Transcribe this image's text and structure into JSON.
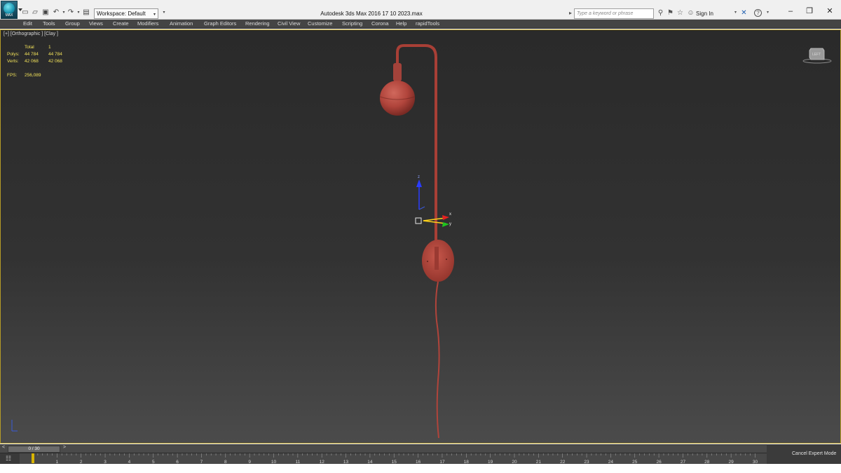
{
  "titlebar": {
    "app_button_label": "MAX",
    "workspace": "Workspace: Default",
    "window_title": "Autodesk 3ds Max 2016     17 10 2023.max",
    "search_placeholder": "Type a keyword or phrase",
    "sign_in": "Sign In"
  },
  "menu": {
    "items": [
      "Edit",
      "Tools",
      "Group",
      "Views",
      "Create",
      "Modifiers",
      "Animation",
      "Graph Editors",
      "Rendering",
      "Civil View",
      "Customize",
      "Scripting",
      "Corona",
      "Help",
      "rapidTools"
    ]
  },
  "viewport": {
    "label": "[+] [Orthographic ] [Clay ]",
    "stats": {
      "header": "Total",
      "header_value": "1",
      "polys_label": "Polys:",
      "polys_selected": "44 784",
      "polys_total": "44 784",
      "verts_label": "Verts:",
      "verts_selected": "42 068",
      "verts_total": "42 068",
      "fps_label": "FPS:",
      "fps_value": "256,089"
    },
    "gizmo_x": "x",
    "gizmo_y": "y",
    "gizmo_z": "z",
    "viewcube_label": "LEFT",
    "model_color": "#b0443b"
  },
  "timeline": {
    "slider_text": "0 / 30",
    "prev": "<",
    "next": ">",
    "ticks": [
      "0",
      "1",
      "2",
      "3",
      "4",
      "5",
      "6",
      "7",
      "8",
      "9",
      "10",
      "11",
      "12",
      "13",
      "14",
      "15",
      "16",
      "17",
      "18",
      "19",
      "20",
      "21",
      "22",
      "23",
      "24",
      "25",
      "26",
      "27",
      "28",
      "29",
      "30"
    ]
  },
  "status": {
    "cancel_expert_mode": "Cancel Expert Mode"
  }
}
